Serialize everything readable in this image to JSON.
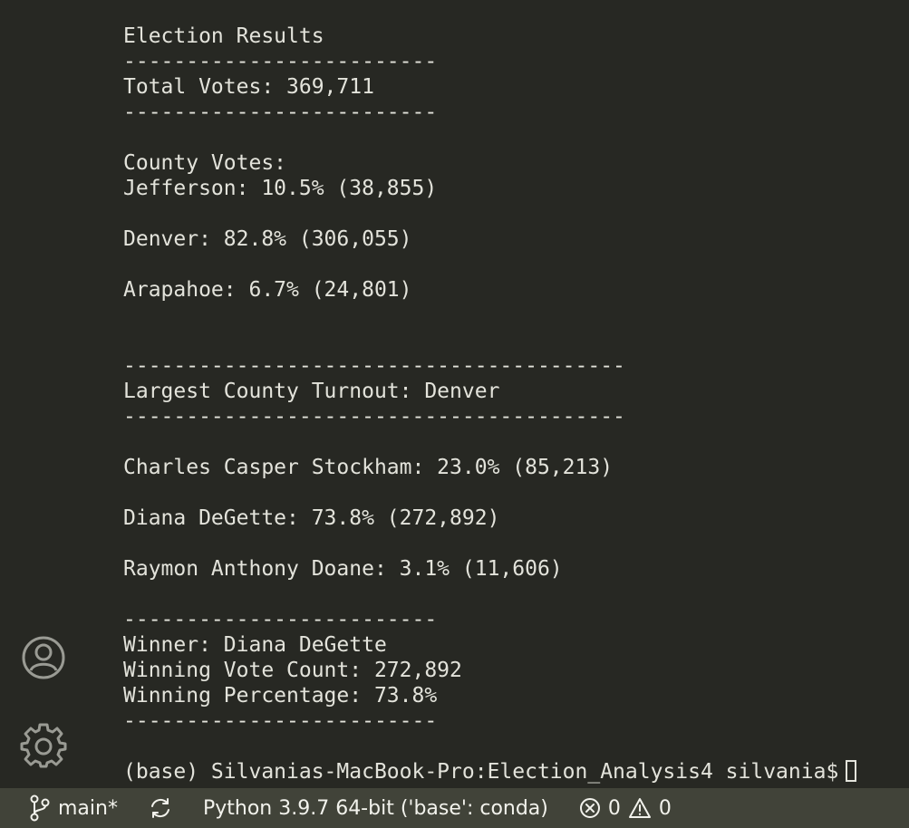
{
  "terminal": {
    "lines": [
      "Election Results",
      "-------------------------",
      "Total Votes: 369,711",
      "-------------------------",
      "",
      "County Votes:",
      "Jefferson: 10.5% (38,855)",
      "",
      "Denver: 82.8% (306,055)",
      "",
      "Arapahoe: 6.7% (24,801)",
      "",
      "",
      "----------------------------------------",
      "Largest County Turnout: Denver",
      "----------------------------------------",
      "",
      "Charles Casper Stockham: 23.0% (85,213)",
      "",
      "Diana DeGette: 73.8% (272,892)",
      "",
      "Raymon Anthony Doane: 3.1% (11,606)",
      "",
      "-------------------------",
      "Winner: Diana DeGette",
      "Winning Vote Count: 272,892",
      "Winning Percentage: 73.8%",
      "-------------------------",
      ""
    ],
    "prompt": "(base) Silvanias-MacBook-Pro:Election_Analysis4 silvania$"
  },
  "activity_bar": {
    "icons": [
      "account-icon",
      "settings-gear-icon"
    ]
  },
  "status_bar": {
    "branch": "main*",
    "interpreter": "Python 3.9.7 64-bit ('base': conda)",
    "errors": "0",
    "warnings": "0"
  },
  "colors": {
    "background": "#272823",
    "status_bar": "#414339",
    "text": "#e3e3db",
    "icon": "#9a9b94"
  }
}
